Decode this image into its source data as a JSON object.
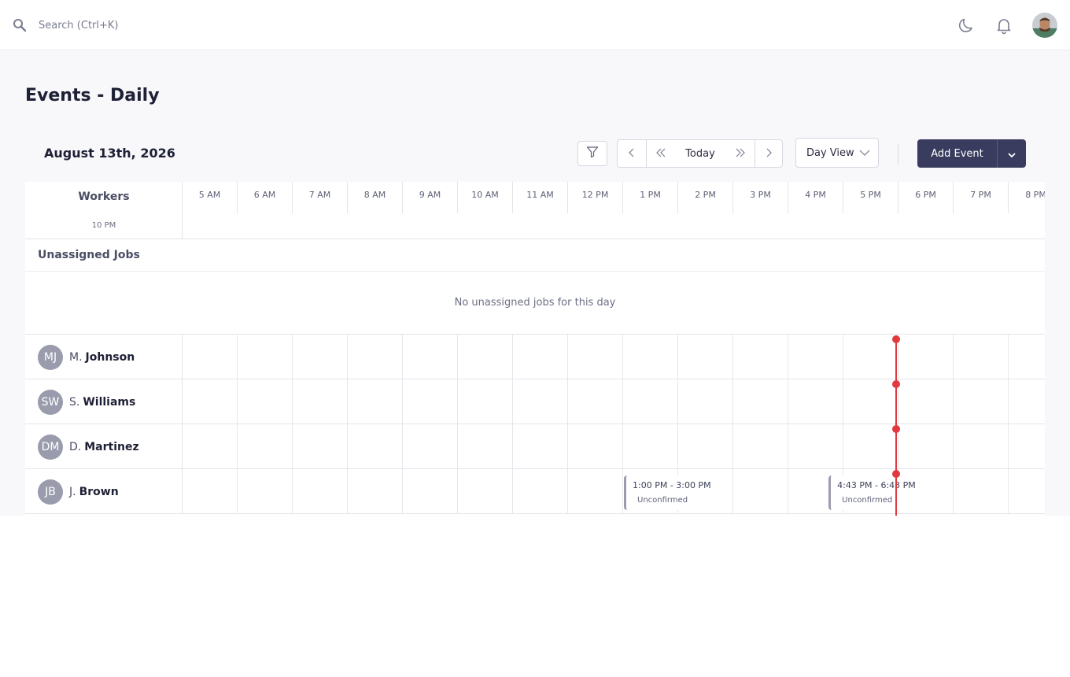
{
  "header": {
    "search_placeholder": "Search (Ctrl+K)",
    "icons": [
      "search-icon",
      "moon-icon",
      "bell-icon",
      "user-avatar"
    ]
  },
  "page": {
    "title": "Events - Daily",
    "date": "August 13th, 2026"
  },
  "toolbar": {
    "today_label": "Today",
    "view_label": "Day View",
    "add_event_label": "Add Event"
  },
  "schedule": {
    "workers_header": "Workers",
    "wrapped_time": "10 PM",
    "hours": [
      "5 AM",
      "6 AM",
      "7 AM",
      "8 AM",
      "9 AM",
      "10 AM",
      "11 AM",
      "12 PM",
      "1 PM",
      "2 PM",
      "3 PM",
      "4 PM",
      "5 PM",
      "6 PM",
      "7 PM",
      "8 PM"
    ],
    "unassigned_title": "Unassigned Jobs",
    "unassigned_empty": "No unassigned jobs for this day",
    "workers": [
      {
        "initials": "MJ",
        "first": "M.",
        "last": "Johnson"
      },
      {
        "initials": "SW",
        "first": "S.",
        "last": "Williams"
      },
      {
        "initials": "DM",
        "first": "D.",
        "last": "Martinez"
      },
      {
        "initials": "JB",
        "first": "J.",
        "last": "Brown"
      }
    ],
    "events": [
      {
        "worker": 3,
        "time": "1:00 PM - 3:00 PM",
        "status": "Unconfirmed"
      },
      {
        "worker": 3,
        "time": "4:43 PM - 6:43 PM",
        "status": "Unconfirmed"
      }
    ],
    "accent_color": "#393c5e",
    "now_color": "#e03a3e"
  }
}
